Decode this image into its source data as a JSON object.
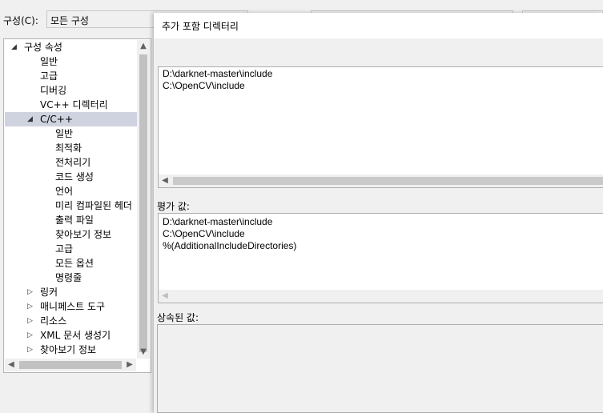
{
  "config": {
    "label": "구성(C):",
    "value": "모든 구성"
  },
  "tree": {
    "items": [
      {
        "label": "구성 속성",
        "level": 0,
        "expander": "expanded"
      },
      {
        "label": "일반",
        "level": 1
      },
      {
        "label": "고급",
        "level": 1
      },
      {
        "label": "디버깅",
        "level": 1
      },
      {
        "label": "VC++ 디렉터리",
        "level": 1
      },
      {
        "label": "C/C++",
        "level": 1,
        "expander": "expanded",
        "selected": true
      },
      {
        "label": "일반",
        "level": 2
      },
      {
        "label": "최적화",
        "level": 2
      },
      {
        "label": "전처리기",
        "level": 2
      },
      {
        "label": "코드 생성",
        "level": 2
      },
      {
        "label": "언어",
        "level": 2
      },
      {
        "label": "미리 컴파일된 헤더",
        "level": 2
      },
      {
        "label": "출력 파일",
        "level": 2
      },
      {
        "label": "찾아보기 정보",
        "level": 2
      },
      {
        "label": "고급",
        "level": 2
      },
      {
        "label": "모든 옵션",
        "level": 2
      },
      {
        "label": "명령줄",
        "level": 2
      },
      {
        "label": "링커",
        "level": 1,
        "expander": "collapsed"
      },
      {
        "label": "매니페스트 도구",
        "level": 1,
        "expander": "collapsed"
      },
      {
        "label": "리소스",
        "level": 1,
        "expander": "collapsed"
      },
      {
        "label": "XML 문서 생성기",
        "level": 1,
        "expander": "collapsed"
      },
      {
        "label": "찾아보기 정보",
        "level": 1,
        "expander": "collapsed"
      }
    ]
  },
  "dialog": {
    "title": "추가 포함 디렉터리",
    "directories": [
      "D:\\darknet-master\\include",
      "C:\\OpenCV\\include"
    ],
    "evaluated_label": "평가 값:",
    "evaluated_values": [
      "D:\\darknet-master\\include",
      "C:\\OpenCV\\include",
      "%(AdditionalIncludeDirectories)"
    ],
    "inherited_label": "상속된 값:"
  },
  "icons": {
    "expanded": "triangle-down-right-icon",
    "collapsed": "triangle-right-icon",
    "scroll_up": "chevron-up-icon",
    "scroll_down": "chevron-down-icon",
    "scroll_left": "chevron-left-icon",
    "scroll_right": "chevron-right-icon"
  },
  "colors": {
    "selection": "#cfd3e0",
    "background": "#f0f0f0",
    "scroll_thumb": "#c1c1c1"
  }
}
